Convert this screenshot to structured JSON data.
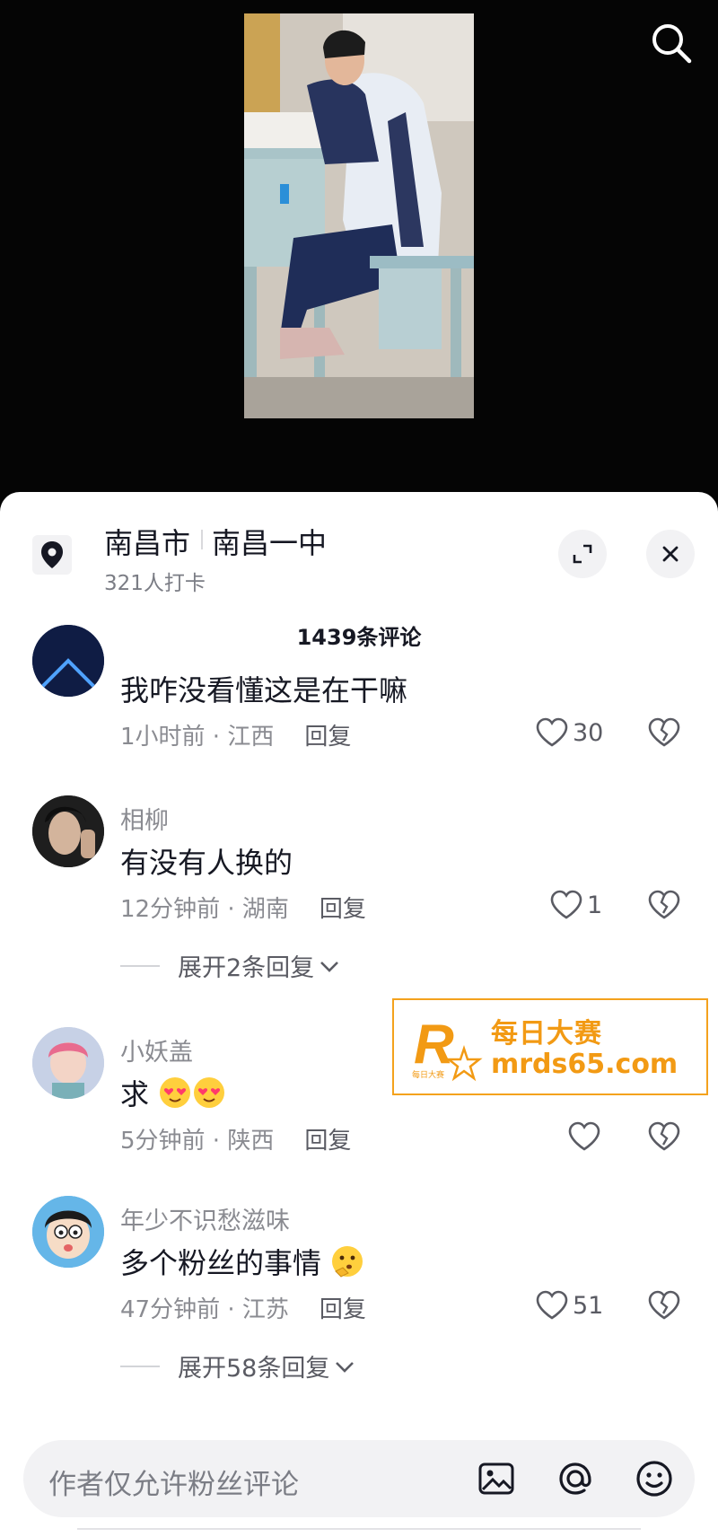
{
  "location": {
    "city": "南昌市",
    "school": "南昌一中",
    "checkin": "321人打卡"
  },
  "comments_header": "1439条评论",
  "comments": [
    {
      "user": "",
      "text": "我咋没看懂这是在干嘛",
      "time": "1小时前 · 江西",
      "reply": "回复",
      "likes": "30",
      "emoji": ""
    },
    {
      "user": "相柳",
      "text": "有没有人换的",
      "time": "12分钟前 · 湖南",
      "reply": "回复",
      "likes": "1",
      "expand": "展开2条回复",
      "emoji": ""
    },
    {
      "user": "小妖盖",
      "text": "求",
      "time": "5分钟前 · 陕西",
      "reply": "回复",
      "likes": "",
      "emoji": "heart-eyes-emoji"
    },
    {
      "user": "年少不识愁滋味",
      "text": "多个粉丝的事情",
      "time": "47分钟前 · 江苏",
      "reply": "回复",
      "likes": "51",
      "expand": "展开58条回复",
      "emoji": "thinking-emoji"
    }
  ],
  "ad": {
    "title": "每日大赛",
    "url": "mrds65.com",
    "logo_letter": "R",
    "logo_sub": "每日大赛"
  },
  "input": {
    "placeholder": "作者仅允许粉丝评论"
  },
  "icons": {
    "search": "search-icon",
    "location": "location-pin-icon",
    "expand": "expand-icon",
    "close": "close-icon",
    "like": "heart-icon",
    "dislike": "broken-heart-icon",
    "chevron": "chevron-down-icon",
    "image": "image-icon",
    "mention": "at-icon",
    "emoji": "emoji-icon"
  },
  "colors": {
    "accent_ad": "#f29a14",
    "text_primary": "#161823",
    "text_secondary": "#8a8b91",
    "sheet_bg": "#ffffff",
    "video_bg": "#050505"
  }
}
